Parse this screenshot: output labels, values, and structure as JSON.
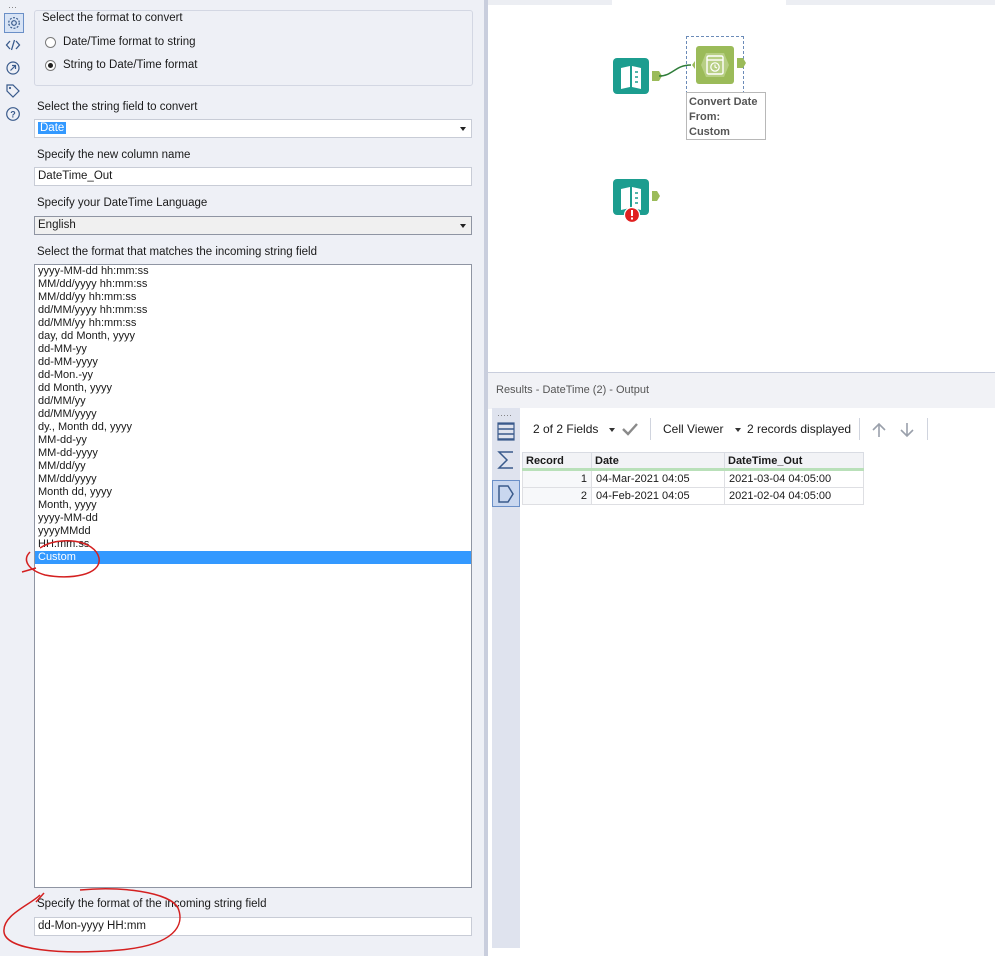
{
  "left_rail": {
    "icons": [
      "gear-icon",
      "code-icon",
      "connection-icon",
      "tag-icon",
      "help-icon"
    ]
  },
  "config": {
    "convert_group": {
      "title": "Select the format to convert",
      "options": [
        {
          "label": "Date/Time format to string",
          "selected": false
        },
        {
          "label": "String to Date/Time format",
          "selected": true
        }
      ]
    },
    "string_field": {
      "label": "Select the string field to convert",
      "value": "Date"
    },
    "new_column": {
      "label": "Specify the new column name",
      "value": "DateTime_Out"
    },
    "language": {
      "label": "Specify your DateTime Language",
      "value": "English"
    },
    "format_list": {
      "label": "Select the format that matches the incoming string field",
      "items": [
        "yyyy-MM-dd hh:mm:ss",
        "MM/dd/yyyy hh:mm:ss",
        "MM/dd/yy hh:mm:ss",
        "dd/MM/yyyy hh:mm:ss",
        "dd/MM/yy hh:mm:ss",
        "day, dd Month, yyyy",
        "dd-MM-yy",
        "dd-MM-yyyy",
        "dd-Mon.-yy",
        "dd Month, yyyy",
        "dd/MM/yy",
        "dd/MM/yyyy",
        "dy., Month dd, yyyy",
        "MM-dd-yy",
        "MM-dd-yyyy",
        "MM/dd/yy",
        "MM/dd/yyyy",
        "Month dd, yyyy",
        "Month, yyyy",
        "yyyy-MM-dd",
        "yyyyMMdd",
        "HH:mm:ss",
        "Custom"
      ],
      "selected": "Custom"
    },
    "custom_format": {
      "label": "Specify the format of the incoming string field",
      "value": "dd-Mon-yyyy HH:mm"
    }
  },
  "canvas": {
    "annotation": [
      "Convert Date",
      "From:",
      "Custom"
    ]
  },
  "results": {
    "title": "Results - DateTime (2) - Output",
    "fields_label": "2 of 2 Fields",
    "cell_viewer_label": "Cell Viewer",
    "records_label": "2 records displayed",
    "columns": [
      "Record",
      "Date",
      "DateTime_Out"
    ],
    "rows": [
      {
        "record": "1",
        "date": "04-Mar-2021 04:05",
        "out": "2021-03-04 04:05:00"
      },
      {
        "record": "2",
        "date": "04-Feb-2021 04:05",
        "out": "2021-02-04 04:05:00"
      }
    ]
  },
  "colors": {
    "selection": "#3399ff",
    "tool_green": "#9bbb59",
    "tool_teal": "#1c9d8f",
    "error_red": "#e02020"
  }
}
